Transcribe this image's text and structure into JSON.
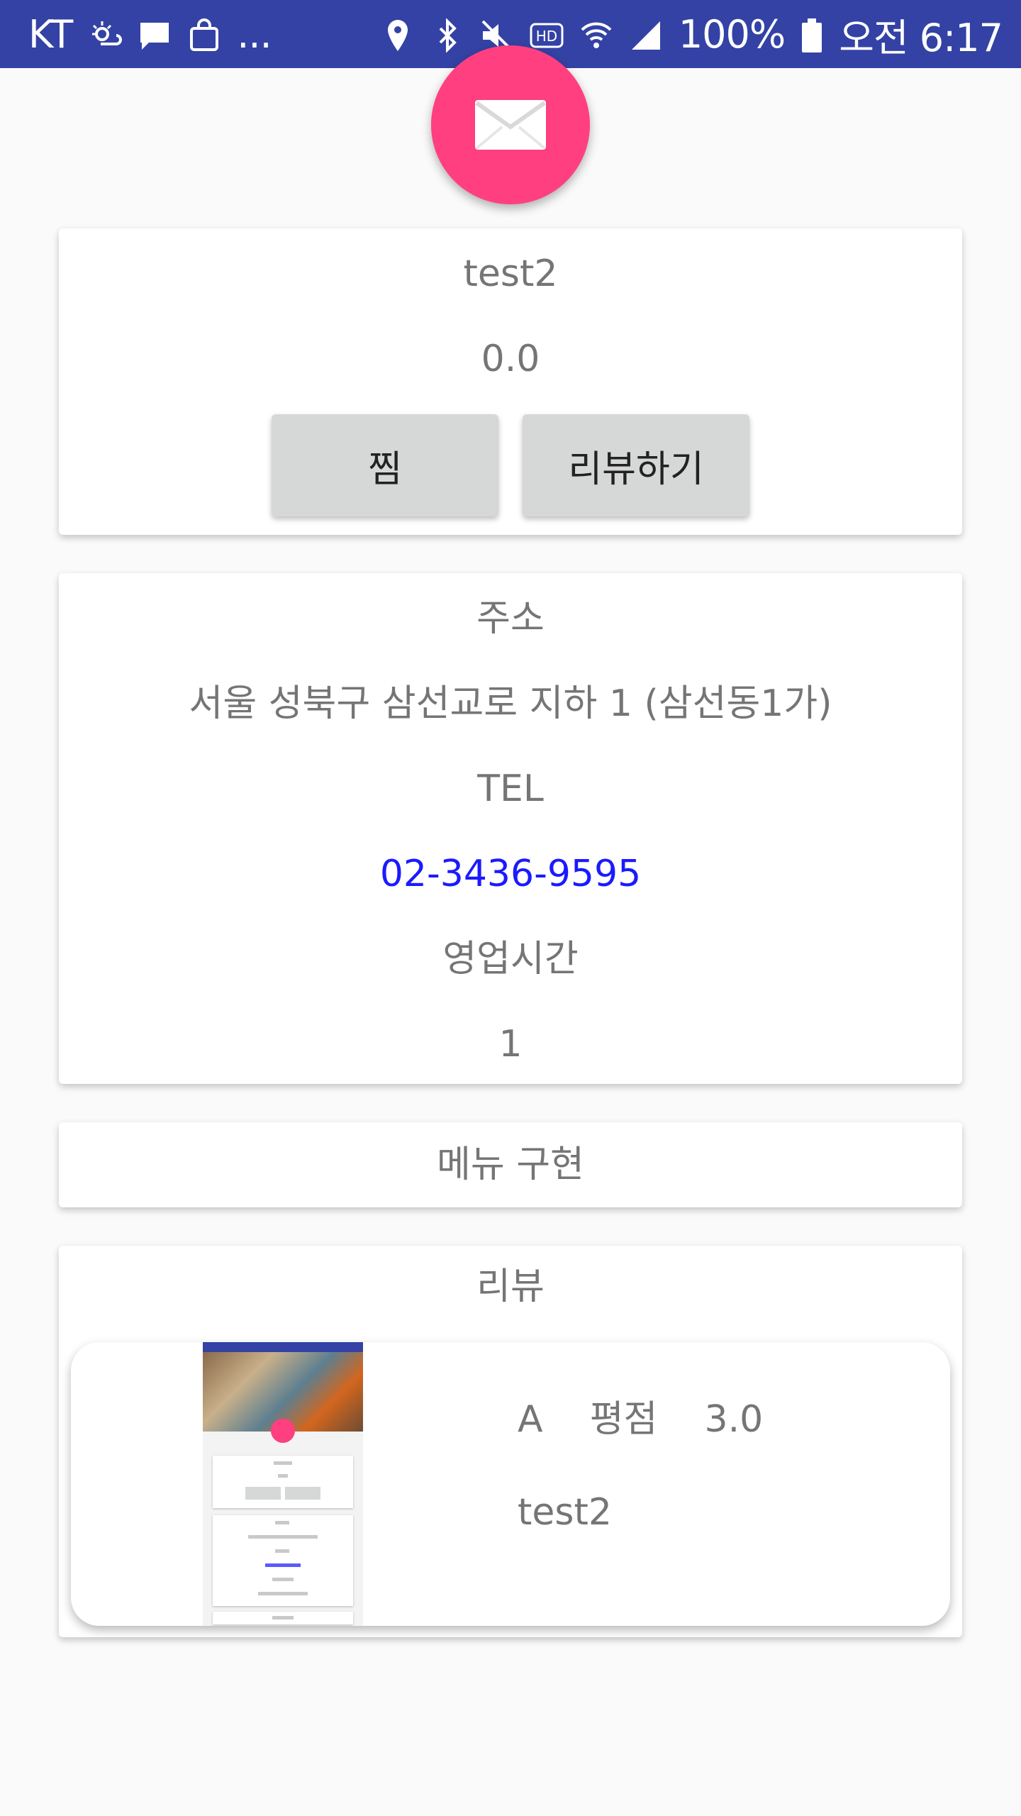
{
  "status_bar": {
    "carrier": "KT",
    "more": "...",
    "battery": "100%",
    "time": "오전 6:17"
  },
  "fab": {
    "icon": "mail-icon",
    "color": "#ff3f80"
  },
  "store": {
    "name": "test2",
    "rating": "0.0",
    "like_label": "찜",
    "review_label": "리뷰하기"
  },
  "info": {
    "address_label": "주소",
    "address": "서울 성북구 삼선교로 지하 1 (삼선동1가)",
    "tel_label": "TEL",
    "tel": "02-3436-9595",
    "hours_label": "영업시간",
    "hours": "1"
  },
  "menu": {
    "label": "메뉴 구현"
  },
  "reviews": {
    "label": "리뷰",
    "items": [
      {
        "user": "A",
        "rating_label": "평점",
        "rating": "3.0",
        "text": "test2"
      }
    ]
  },
  "colors": {
    "status_bar": "#3342a4",
    "accent": "#ff3f80",
    "link": "#1a1aff"
  }
}
